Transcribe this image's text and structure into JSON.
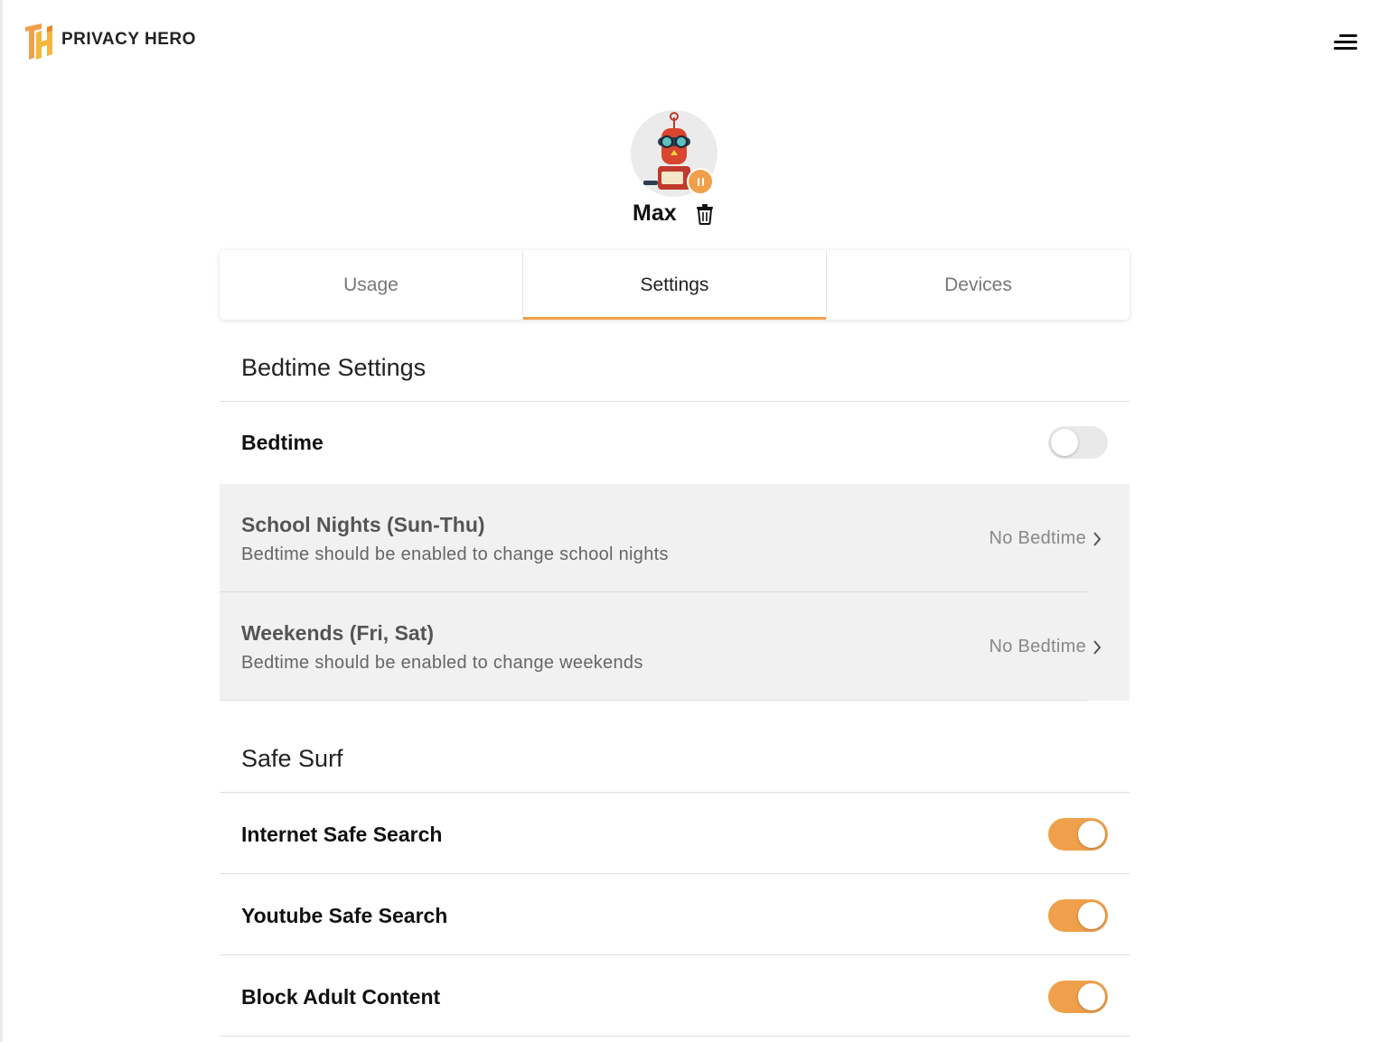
{
  "brand": {
    "name": "PRIVACY HERO",
    "accent": "#f0a04b"
  },
  "header": {
    "menu_icon": "hamburger-menu-icon"
  },
  "profile": {
    "name": "Max",
    "status": "paused",
    "delete_icon": "trash-icon"
  },
  "tabs": [
    {
      "label": "Usage",
      "active": false
    },
    {
      "label": "Settings",
      "active": true
    },
    {
      "label": "Devices",
      "active": false
    }
  ],
  "bedtime": {
    "title": "Bedtime Settings",
    "toggle_label": "Bedtime",
    "enabled": false,
    "items": [
      {
        "title": "School Nights (Sun-Thu)",
        "subtitle": "Bedtime should be enabled to change school nights",
        "value": "No Bedtime"
      },
      {
        "title": "Weekends (Fri, Sat)",
        "subtitle": "Bedtime should be enabled to change weekends",
        "value": "No Bedtime"
      }
    ]
  },
  "safe_surf": {
    "title": "Safe Surf",
    "items": [
      {
        "label": "Internet Safe Search",
        "enabled": true
      },
      {
        "label": "Youtube Safe Search",
        "enabled": true
      },
      {
        "label": "Block Adult Content",
        "enabled": true
      }
    ]
  }
}
